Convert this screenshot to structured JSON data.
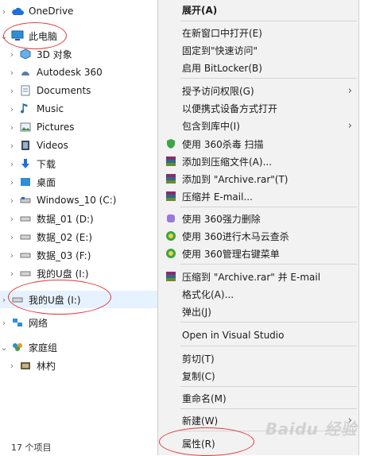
{
  "nav": {
    "items": [
      {
        "label": "OneDrive",
        "icon": "cloud-icon",
        "chev": "›"
      },
      {
        "label": "此电脑",
        "icon": "pc-icon",
        "chev": "⌄"
      },
      {
        "label": "3D 对象",
        "icon": "cube-icon",
        "chev": "›"
      },
      {
        "label": "Autodesk 360",
        "icon": "autodesk-icon",
        "chev": "›"
      },
      {
        "label": "Documents",
        "icon": "documents-icon",
        "chev": "›"
      },
      {
        "label": "Music",
        "icon": "music-icon",
        "chev": "›"
      },
      {
        "label": "Pictures",
        "icon": "pictures-icon",
        "chev": "›"
      },
      {
        "label": "Videos",
        "icon": "videos-icon",
        "chev": "›"
      },
      {
        "label": "下载",
        "icon": "download-icon",
        "chev": "›"
      },
      {
        "label": "桌面",
        "icon": "desktop-icon",
        "chev": "›"
      },
      {
        "label": "Windows_10 (C:)",
        "icon": "drive-icon",
        "chev": "›"
      },
      {
        "label": "数据_01 (D:)",
        "icon": "drive-icon",
        "chev": "›"
      },
      {
        "label": "数据_02 (E:)",
        "icon": "drive-icon",
        "chev": "›"
      },
      {
        "label": "数据_03 (F:)",
        "icon": "drive-icon",
        "chev": "›"
      },
      {
        "label": "我的U盘 (I:)",
        "icon": "usb-drive-icon",
        "chev": "›"
      },
      {
        "label": "我的U盘 (I:)",
        "icon": "usb-drive-icon",
        "chev": "›"
      },
      {
        "label": "网络",
        "icon": "network-icon",
        "chev": "›"
      },
      {
        "label": "家庭组",
        "icon": "homegroup-icon",
        "chev": "⌄"
      },
      {
        "label": "林杓",
        "icon": "user-icon",
        "chev": "›"
      }
    ],
    "status": "17 个项目"
  },
  "menu": {
    "items": [
      {
        "label": "展开(A)",
        "bold": true
      },
      {
        "label": "在新窗口中打开(E)"
      },
      {
        "label": "固定到\"快速访问\""
      },
      {
        "label": "启用 BitLocker(B)"
      },
      {
        "label": "授予访问权限(G)",
        "arrow": "›"
      },
      {
        "label": "以便携式设备方式打开"
      },
      {
        "label": "包含到库中(I)",
        "arrow": "›"
      },
      {
        "label": "使用 360杀毒 扫描",
        "icon": "shield-icon"
      },
      {
        "label": "添加到压缩文件(A)...",
        "icon": "archive-icon"
      },
      {
        "label": "添加到 \"Archive.rar\"(T)",
        "icon": "archive-icon"
      },
      {
        "label": "压缩并 E-mail...",
        "icon": "archive-icon"
      },
      {
        "label": "使用 360强力删除",
        "icon": "delete-icon"
      },
      {
        "label": "使用 360进行木马云查杀",
        "icon": "scan-icon"
      },
      {
        "label": "使用 360管理右键菜单",
        "icon": "scan-icon"
      },
      {
        "label": "压缩到 \"Archive.rar\" 并 E-mail",
        "icon": "archive-icon"
      },
      {
        "label": "格式化(A)..."
      },
      {
        "label": "弹出(J)"
      },
      {
        "label": "Open in Visual Studio"
      },
      {
        "label": "剪切(T)"
      },
      {
        "label": "复制(C)"
      },
      {
        "label": "重命名(M)"
      },
      {
        "label": "新建(W)",
        "arrow": "›"
      },
      {
        "label": "属性(R)"
      }
    ]
  },
  "watermark": "Baidu 经验",
  "colors": {
    "annotation": "#e0393e",
    "menu_bg": "#f2f2f2",
    "selection": "#e6f2ff"
  }
}
